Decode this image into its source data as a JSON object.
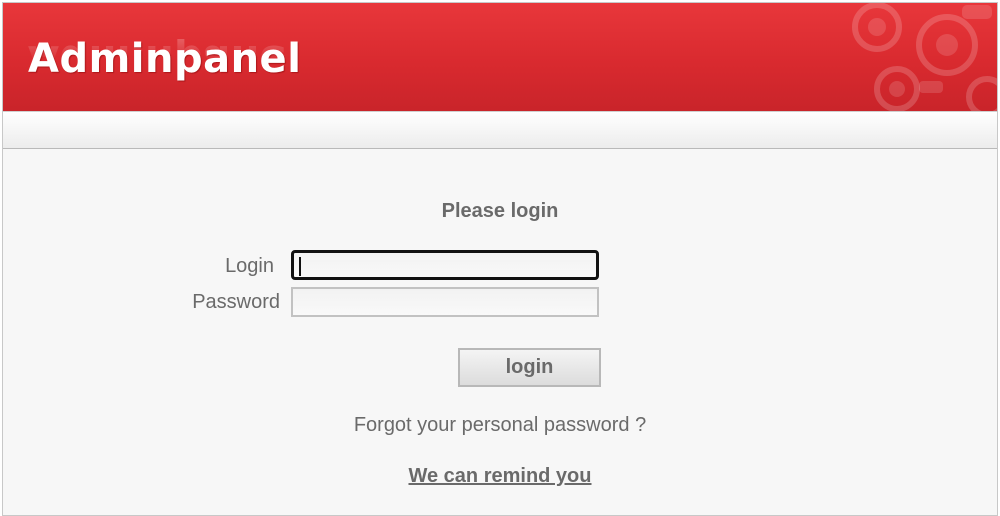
{
  "header": {
    "brand": "Adminpanel",
    "colors": {
      "primary_red": "#d92a2f",
      "page_bg": "#f7f7f7",
      "text_gray": "#6a6a6a"
    },
    "decoration_icon": "gear-pattern-icon"
  },
  "form": {
    "title": "Please login",
    "login_label": "Login",
    "login_value": "",
    "password_label": "Password",
    "password_value": "",
    "submit_label": "login"
  },
  "recovery": {
    "question": "Forgot your personal password ?",
    "link_label": "We can remind you"
  }
}
